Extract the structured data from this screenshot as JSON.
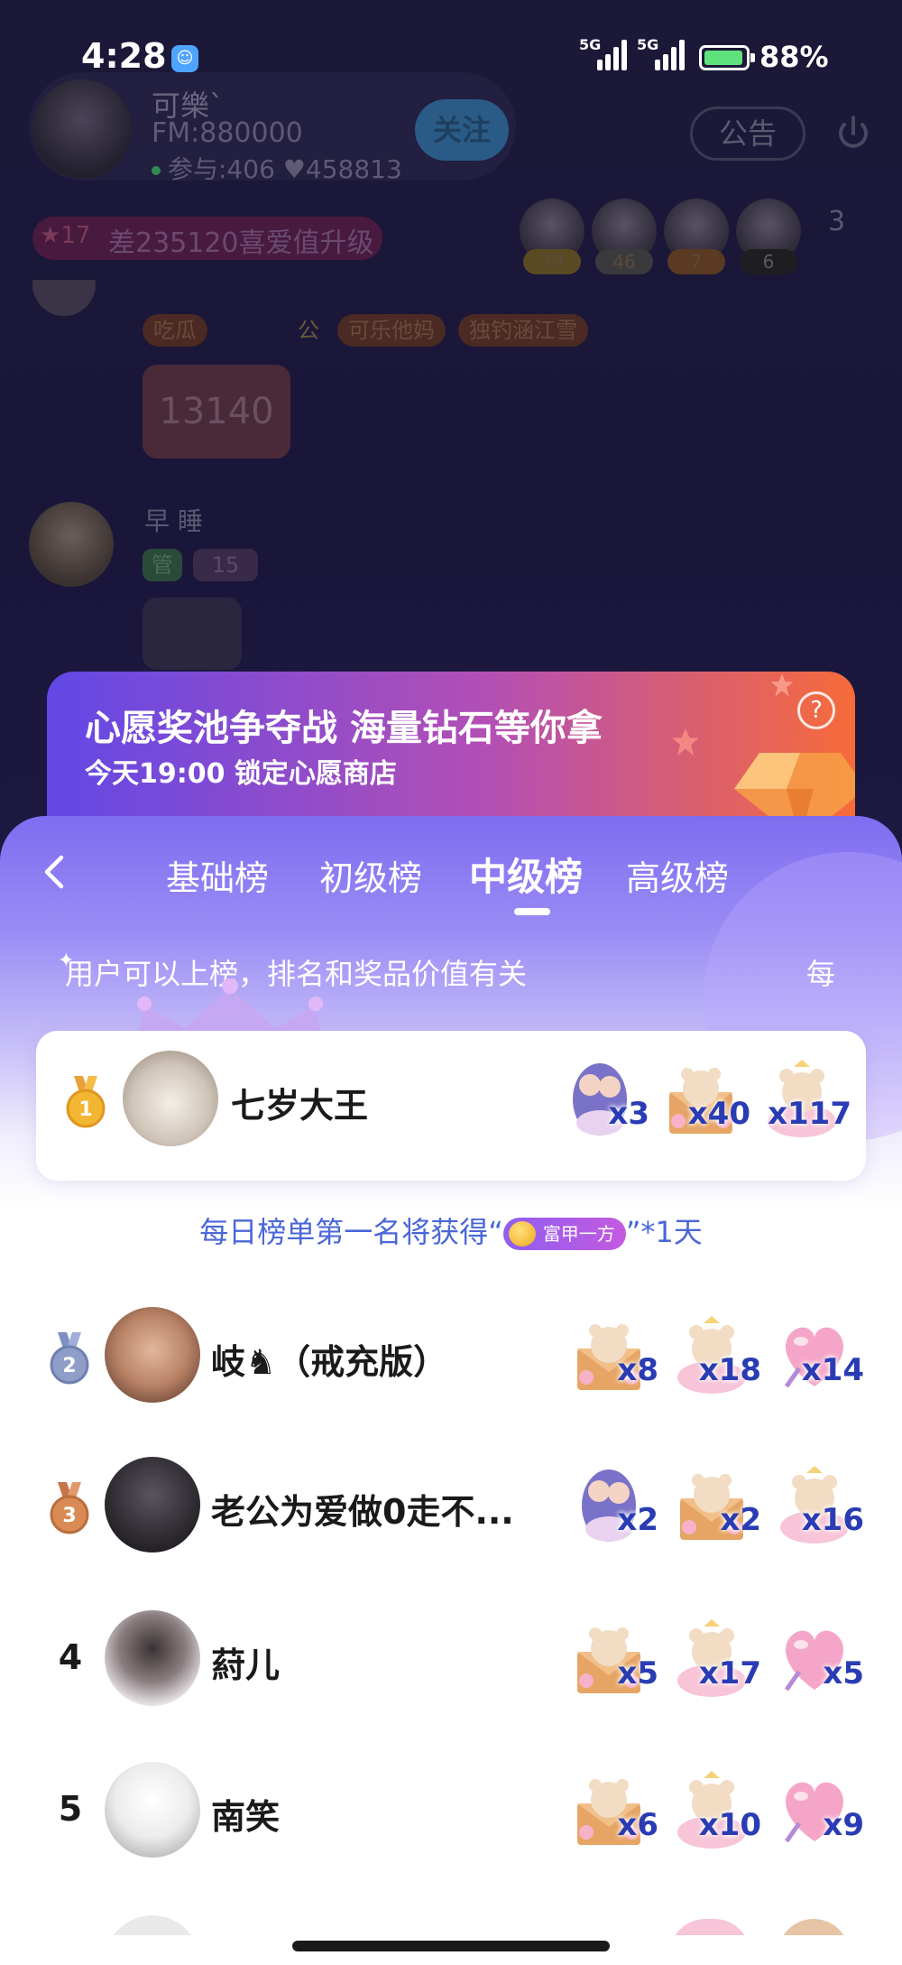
{
  "status_bar": {
    "time": "4:28",
    "signal_1_label": "5G",
    "signal_2_label": "5G",
    "battery": "88%"
  },
  "room": {
    "host_name": "可樂`",
    "host_fm": "FM:880000",
    "host_stats": "参与:406  ♥458813",
    "follow_label": "关注",
    "notice_label": "公告",
    "love_level": "17",
    "love_text": "差235120喜爱值升级",
    "viewers": [
      {
        "count": "79",
        "color": "#a08a4a"
      },
      {
        "count": "46",
        "color": "#7a7a7a"
      },
      {
        "count": "7",
        "color": "#9a6a3a"
      },
      {
        "count": "6",
        "color": "#3a3a3a"
      }
    ],
    "viewers_more": "3",
    "chat_badges": [
      "吃瓜",
      "公",
      "可乐他妈",
      "独钓涵江雪"
    ],
    "gift_number": "13140",
    "chat2_name": "早 睡",
    "chat2_badge_role": "管",
    "chat2_badge_level": "15"
  },
  "wish_banner": {
    "title": "心愿奖池争夺战 海量钻石等你拿",
    "subtitle": "今天19:00 锁定心愿商店",
    "help": "?"
  },
  "ranking": {
    "tabs": [
      {
        "label": "基础榜",
        "active": false
      },
      {
        "label": "初级榜",
        "active": false
      },
      {
        "label": "中级榜",
        "active": true
      },
      {
        "label": "高级榜",
        "active": false
      }
    ],
    "marquee": "用户可以上榜，排名和奖品价值有关",
    "marquee_tail": "每",
    "reward_prefix": "每日榜单第一名将获得“",
    "reward_badge": "富甲一方",
    "reward_suffix": "”*1天",
    "entries": [
      {
        "rank": "1",
        "name": "七岁大王",
        "gifts": [
          {
            "icon": "couple-gift-icon",
            "count": "x3"
          },
          {
            "icon": "bear-envelope-gift-icon",
            "count": "x40"
          },
          {
            "icon": "bear-angel-gift-icon",
            "count": "x117"
          }
        ]
      },
      {
        "rank": "2",
        "name": "岐♞（戒充版）",
        "gifts": [
          {
            "icon": "bear-envelope-gift-icon",
            "count": "x8"
          },
          {
            "icon": "bear-angel-gift-icon",
            "count": "x18"
          },
          {
            "icon": "heart-balloon-gift-icon",
            "count": "x14"
          }
        ]
      },
      {
        "rank": "3",
        "name": "老公为爱做0走不...",
        "gifts": [
          {
            "icon": "couple-gift-icon",
            "count": "x2"
          },
          {
            "icon": "bear-envelope-gift-icon",
            "count": "x2"
          },
          {
            "icon": "bear-angel-gift-icon",
            "count": "x16"
          }
        ]
      },
      {
        "rank": "4",
        "name": "葤儿",
        "gifts": [
          {
            "icon": "bear-envelope-gift-icon",
            "count": "x5"
          },
          {
            "icon": "bear-angel-gift-icon",
            "count": "x17"
          },
          {
            "icon": "heart-balloon-gift-icon",
            "count": "x5"
          }
        ]
      },
      {
        "rank": "5",
        "name": "南笑",
        "gifts": [
          {
            "icon": "bear-envelope-gift-icon",
            "count": "x6"
          },
          {
            "icon": "bear-angel-gift-icon",
            "count": "x10"
          },
          {
            "icon": "heart-balloon-gift-icon",
            "count": "x9"
          }
        ]
      }
    ]
  },
  "colors": {
    "accent_blue": "#4a66d8",
    "gift_count": "#2a3cb4",
    "gold": "#f2b632",
    "silver": "#8f9ec9",
    "bronze": "#d98a55"
  }
}
